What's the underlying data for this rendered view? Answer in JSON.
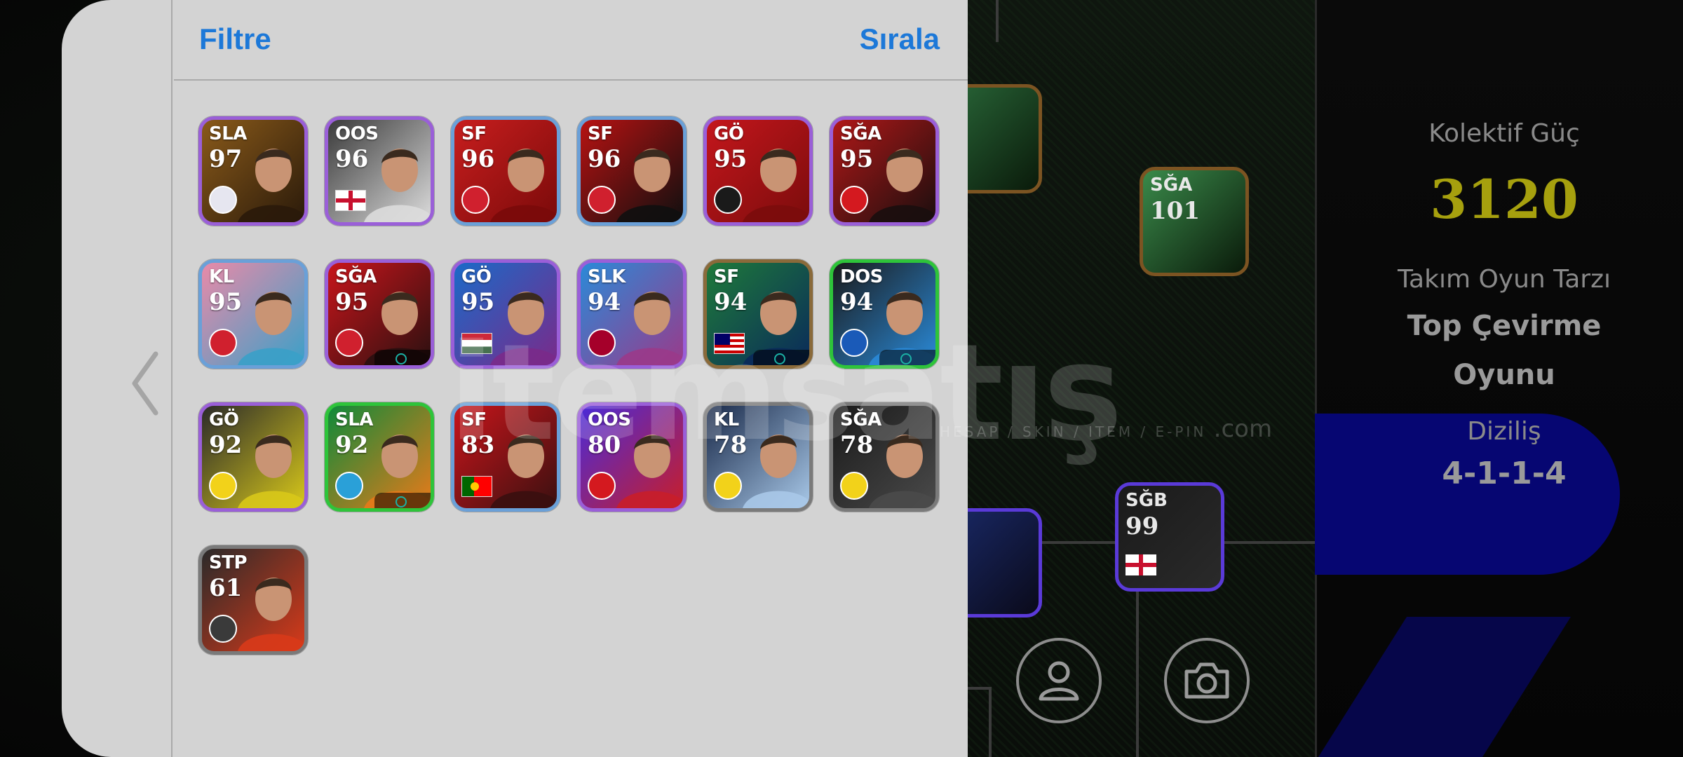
{
  "panel": {
    "filter_label": "Filtre",
    "sort_label": "Sırala",
    "collapse_icon": "chevron-left-icon"
  },
  "cards": [
    {
      "pos": "SLA",
      "rating": "97",
      "bg": "#8a5a1a",
      "bg2": "#2a1a0a",
      "frame": "#9a5fd8",
      "mark": "badge",
      "mark_color": "#e6e6f0"
    },
    {
      "pos": "OOS",
      "rating": "96",
      "bg": "#3a3a3a",
      "bg2": "#dcdcdc",
      "frame": "#9a5fd8",
      "mark": "flag-england",
      "mark_color": "#ffffff"
    },
    {
      "pos": "SF",
      "rating": "96",
      "bg": "#c81e1e",
      "bg2": "#7a0a0a",
      "frame": "#6aa0d8",
      "mark": "badge",
      "mark_color": "#d0202e"
    },
    {
      "pos": "SF",
      "rating": "96",
      "bg": "#b81212",
      "bg2": "#0f0f0f",
      "frame": "#6aa0d8",
      "mark": "badge",
      "mark_color": "#d0202e"
    },
    {
      "pos": "GÖ",
      "rating": "95",
      "bg": "#c4161c",
      "bg2": "#7b0c0c",
      "frame": "#9a5fd8",
      "mark": "badge",
      "mark_color": "#1a1a1a"
    },
    {
      "pos": "SĞA",
      "rating": "95",
      "bg": "#b01818",
      "bg2": "#1a0e0e",
      "frame": "#9a5fd8",
      "mark": "badge",
      "mark_color": "#d4191f"
    },
    {
      "pos": "KL",
      "rating": "95",
      "bg": "#e98aa8",
      "bg2": "#3aa0c8",
      "frame": "#6aa0d8",
      "mark": "badge",
      "mark_color": "#d0202e"
    },
    {
      "pos": "SĞA",
      "rating": "95",
      "bg": "#c8151b",
      "bg2": "#2a1010",
      "frame": "#9a5fd8",
      "mark": "badge",
      "mark_color": "#d0202e",
      "skill": true
    },
    {
      "pos": "GÖ",
      "rating": "95",
      "bg": "#1a6ac8",
      "bg2": "#7a2a8a",
      "frame": "#9a5fd8",
      "mark": "flag-hungary",
      "mark_color": "#ffffff"
    },
    {
      "pos": "SLK",
      "rating": "94",
      "bg": "#2a8ad8",
      "bg2": "#9a3a8a",
      "frame": "#9a5fd8",
      "mark": "badge",
      "mark_color": "#a5002a"
    },
    {
      "pos": "SF",
      "rating": "94",
      "bg": "#1e7a3a",
      "bg2": "#0a2a5a",
      "frame": "#8a6a3a",
      "mark": "flag-malaysia",
      "mark_color": "#ffffff",
      "skill": true
    },
    {
      "pos": "DOS",
      "rating": "94",
      "bg": "#1a1a1a",
      "bg2": "#2a8ad8",
      "frame": "#2ec43a",
      "mark": "badge",
      "mark_color": "#1a5ab8",
      "skill": true
    },
    {
      "pos": "GÖ",
      "rating": "92",
      "bg": "#2a2a2a",
      "bg2": "#d8c81a",
      "frame": "#9a5fd8",
      "mark": "badge",
      "mark_color": "#f2d21a"
    },
    {
      "pos": "SLA",
      "rating": "92",
      "bg": "#0e8a3a",
      "bg2": "#e87a1a",
      "frame": "#2ec43a",
      "mark": "badge",
      "mark_color": "#2aa0d8",
      "skill": true
    },
    {
      "pos": "SF",
      "rating": "83",
      "bg": "#c8151b",
      "bg2": "#3a1010",
      "frame": "#6aa0d8",
      "mark": "flag-portugal",
      "mark_color": "#ffffff"
    },
    {
      "pos": "OOS",
      "rating": "80",
      "bg": "#4a2ad8",
      "bg2": "#c81e2a",
      "frame": "#9a5fd8",
      "mark": "badge",
      "mark_color": "#d4191f"
    },
    {
      "pos": "KL",
      "rating": "78",
      "bg": "#1a2a4a",
      "bg2": "#a8c8e8",
      "frame": "#7a7a7a",
      "mark": "badge",
      "mark_color": "#f2d21a"
    },
    {
      "pos": "SĞA",
      "rating": "78",
      "bg": "#1a1a1a",
      "bg2": "#4a4a4a",
      "frame": "#7a7a7a",
      "mark": "badge",
      "mark_color": "#f2d21a"
    },
    {
      "pos": "STP",
      "rating": "61",
      "bg": "#2a2a2a",
      "bg2": "#d83a1a",
      "frame": "#7a7a7a",
      "mark": "badge",
      "mark_color": "#3a3a3a"
    }
  ],
  "pitch_cards": [
    {
      "pos": "SĞA",
      "rating": "101"
    },
    {
      "pos": "SĞB",
      "rating": "99"
    }
  ],
  "team": {
    "power_label": "Kolektif Güç",
    "power_value": "3120",
    "style_label": "Takım Oyun Tarzı",
    "style_value_line1": "Top Çevirme",
    "style_value_line2": "Oyunu",
    "formation_label": "Diziliş",
    "formation_value": "4-1-1-4"
  },
  "buttons": {
    "profile_icon": "person-icon",
    "camera_icon": "camera-icon"
  },
  "watermark": {
    "main": "itemsatış",
    "sub": "HESAP / SKIN / ITEM / E-PIN",
    "domain": ".com"
  }
}
